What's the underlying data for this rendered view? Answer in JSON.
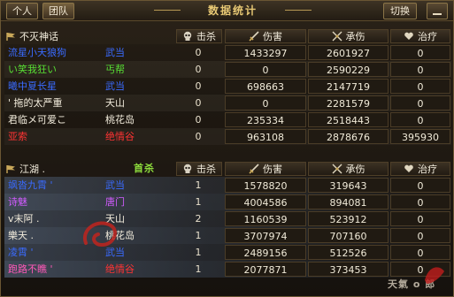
{
  "tabs": [
    "个人",
    "团队"
  ],
  "window_title": "数据统计",
  "switch_label": "切换",
  "stamp_text": "首杀",
  "signature_text": "天氣 o 郎",
  "columns": {
    "kills": "击杀",
    "damage": "伤害",
    "taken": "承伤",
    "heal": "治疗"
  },
  "colors": {
    "blue": "#3a6bff",
    "green": "#58e034",
    "red": "#ff3333",
    "purple": "#d15cff",
    "pink": "#ff58b8",
    "white": "#f2ecdc",
    "title_gold": "#e7c874"
  },
  "icons": [
    "flag-icon",
    "skull-icon",
    "sword-icon",
    "crossed-swords-icon",
    "heart-hand-icon",
    "minimize-icon"
  ],
  "teams": [
    {
      "name": "不灭神话",
      "players": [
        {
          "name": "流星小天狼狗",
          "sect": "武当",
          "name_color": "blue",
          "sect_color": "blue",
          "kills": "0",
          "damage": "1433297",
          "taken": "2601927",
          "heal": "0"
        },
        {
          "name": "い笑我狂い",
          "sect": "丐帮",
          "name_color": "green",
          "sect_color": "green",
          "kills": "0",
          "damage": "0",
          "taken": "2590229",
          "heal": "0"
        },
        {
          "name": "曦中夏长星",
          "sect": "武当",
          "name_color": "blue",
          "sect_color": "blue",
          "kills": "0",
          "damage": "698663",
          "taken": "2147719",
          "heal": "0"
        },
        {
          "name": "' 拖的太严重",
          "sect": "天山",
          "name_color": "white",
          "sect_color": "white",
          "kills": "0",
          "damage": "0",
          "taken": "2281579",
          "heal": "0"
        },
        {
          "name": "君临メ可爱こ",
          "sect": "桃花岛",
          "name_color": "white",
          "sect_color": "white",
          "kills": "0",
          "damage": "235334",
          "taken": "2518443",
          "heal": "0"
        },
        {
          "name": "亚索",
          "sect": "绝情谷",
          "name_color": "red",
          "sect_color": "red",
          "kills": "0",
          "damage": "963108",
          "taken": "2878676",
          "heal": "395930"
        }
      ]
    },
    {
      "name": "江湖 .",
      "players": [
        {
          "name": "飒沓九霄 '",
          "sect": "武当",
          "name_color": "blue",
          "sect_color": "blue",
          "kills": "1",
          "damage": "1578820",
          "taken": "319643",
          "heal": "0"
        },
        {
          "name": "诗魅",
          "sect": "唐门",
          "name_color": "purple",
          "sect_color": "purple",
          "kills": "1",
          "damage": "4004586",
          "taken": "894081",
          "heal": "0"
        },
        {
          "name": "v末阿 .",
          "sect": "天山",
          "name_color": "white",
          "sect_color": "white",
          "kills": "2",
          "damage": "1160539",
          "taken": "523912",
          "heal": "0"
        },
        {
          "name": "樂天 .",
          "sect": "桃花岛",
          "name_color": "white",
          "sect_color": "white",
          "kills": "1",
          "damage": "3707974",
          "taken": "707160",
          "heal": "0"
        },
        {
          "name": "凌霄 '",
          "sect": "武当",
          "name_color": "blue",
          "sect_color": "blue",
          "kills": "1",
          "damage": "2489156",
          "taken": "512526",
          "heal": "0"
        },
        {
          "name": "跑路不瞧 '",
          "sect": "绝情谷",
          "name_color": "pink",
          "sect_color": "red",
          "kills": "1",
          "damage": "2077871",
          "taken": "373453",
          "heal": "0"
        }
      ]
    }
  ]
}
